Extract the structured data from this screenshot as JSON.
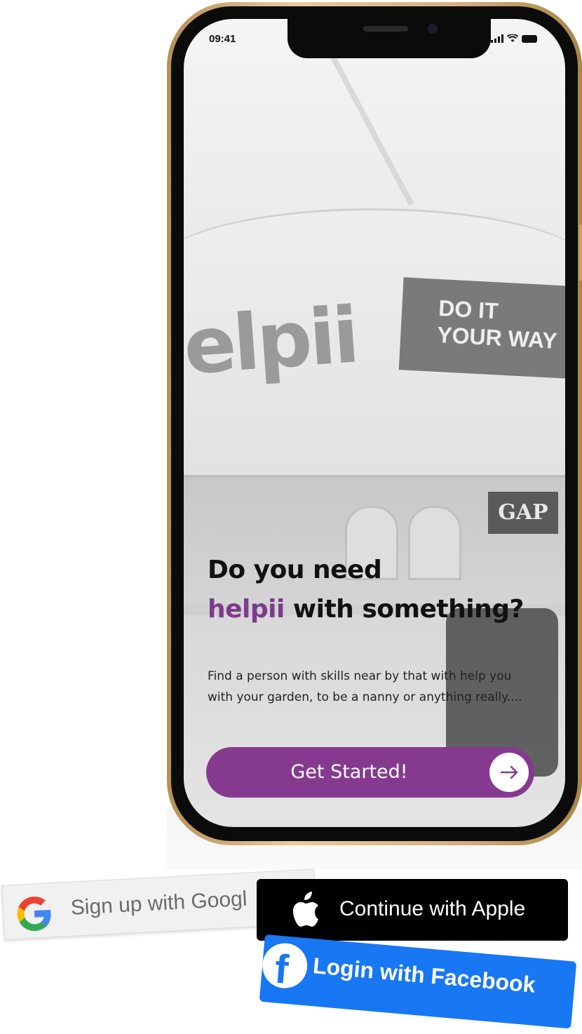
{
  "status_bar": {
    "time": "09:41"
  },
  "background": {
    "billboard_logo": "elpii",
    "billboard_slogan_line1": "DO IT",
    "billboard_slogan_line2": "YOUR WAY",
    "store_sign": "GAP"
  },
  "hero": {
    "headline_line1": "Do you need",
    "headline_brand": "helpii",
    "headline_rest": " with something?",
    "description": "Find a person with skills near by that with help you with your garden, to be a nanny or anything really....",
    "cta_label": "Get Started!",
    "cta_icon": "arrow-right-icon"
  },
  "social_buttons": {
    "google_label": "Sign up with Googl",
    "apple_label": "Continue with Apple",
    "facebook_label": "Login with Facebook"
  },
  "colors": {
    "brand_purple": "#863a8f",
    "facebook_blue": "#1877f2",
    "apple_black": "#000000"
  }
}
